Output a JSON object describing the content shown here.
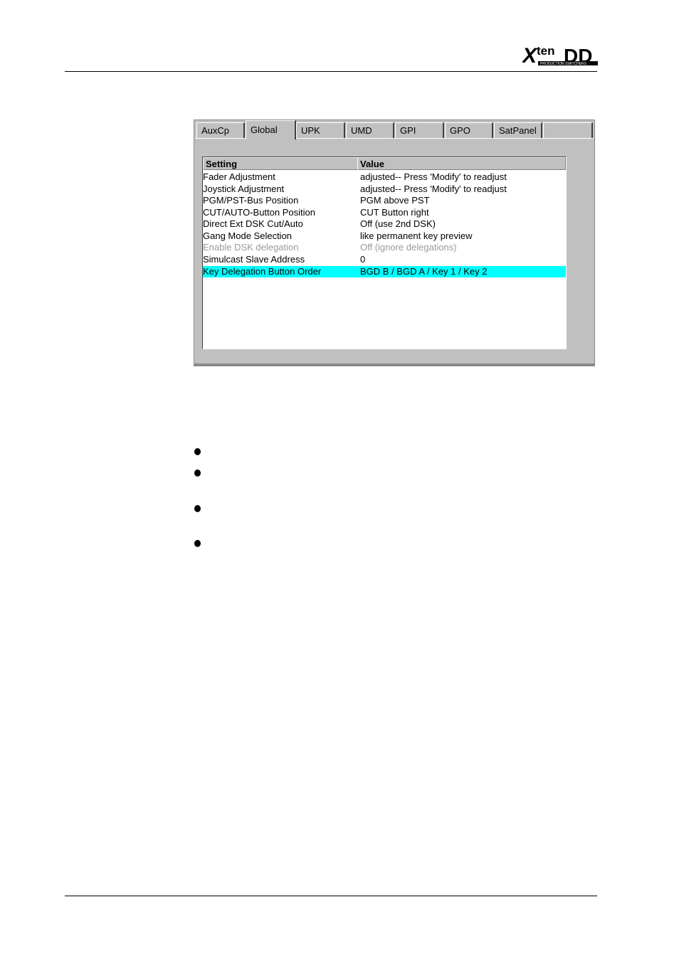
{
  "logo": {
    "main_text": "Xten DD",
    "tagline": "PRODUCTION SWITCHERS"
  },
  "tabs": [
    {
      "label": "AuxCp",
      "active": false
    },
    {
      "label": "Global",
      "active": true
    },
    {
      "label": "UPK",
      "active": false
    },
    {
      "label": "UMD",
      "active": false
    },
    {
      "label": "GPI",
      "active": false
    },
    {
      "label": "GPO",
      "active": false
    },
    {
      "label": "SatPanel",
      "active": false
    },
    {
      "label": "",
      "active": false
    }
  ],
  "table": {
    "columns": [
      "Setting",
      "Value"
    ],
    "rows": [
      {
        "setting": "Fader Adjustment",
        "value": "adjusted-- Press 'Modify' to readjust",
        "state": "normal"
      },
      {
        "setting": "Joystick Adjustment",
        "value": "adjusted-- Press 'Modify' to readjust",
        "state": "normal"
      },
      {
        "setting": "PGM/PST-Bus Position",
        "value": "PGM above PST",
        "state": "normal"
      },
      {
        "setting": "CUT/AUTO-Button Position",
        "value": "CUT Button right",
        "state": "normal"
      },
      {
        "setting": "Direct Ext DSK Cut/Auto",
        "value": "Off (use 2nd DSK)",
        "state": "normal"
      },
      {
        "setting": "Gang Mode Selection",
        "value": "like permanent key preview",
        "state": "normal"
      },
      {
        "setting": "Enable DSK delegation",
        "value": "Off (ignore delegations)",
        "state": "disabled"
      },
      {
        "setting": "Simulcast Slave Address",
        "value": "0",
        "state": "normal"
      },
      {
        "setting": "Key Delegation Button Order",
        "value": "BGD B / BGD A / Key 1 / Key 2",
        "state": "selected"
      }
    ]
  },
  "colors": {
    "selection": "#00ffff",
    "panel": "#c0c0c0",
    "disabled_text": "#9a9a9a"
  }
}
